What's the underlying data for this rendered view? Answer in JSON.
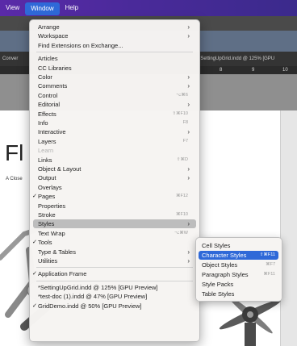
{
  "menubar": {
    "items": [
      {
        "label": "View",
        "active": false
      },
      {
        "label": "Window",
        "active": true
      },
      {
        "label": "Help",
        "active": false
      }
    ]
  },
  "background": {
    "doc_left_text": "Conver",
    "doc_title": "*SettingUpGrid.indd @ 125% [GPU",
    "ruler_ticks": [
      "8",
      "9",
      "10"
    ],
    "page_heading": "Fl",
    "page_subheading": "A Close"
  },
  "window_menu": {
    "items": [
      {
        "label": "Arrange",
        "shortcut": "",
        "submenu": true,
        "disabled": false,
        "checked": false
      },
      {
        "label": "Workspace",
        "shortcut": "",
        "submenu": true,
        "disabled": false,
        "checked": false
      },
      {
        "label": "Find Extensions on Exchange...",
        "shortcut": "",
        "submenu": false,
        "disabled": false,
        "checked": false
      },
      {
        "sep": true
      },
      {
        "label": "Articles",
        "shortcut": "",
        "submenu": false,
        "disabled": false,
        "checked": false
      },
      {
        "label": "CC Libraries",
        "shortcut": "",
        "submenu": false,
        "disabled": false,
        "checked": false
      },
      {
        "label": "Color",
        "shortcut": "",
        "submenu": true,
        "disabled": false,
        "checked": false
      },
      {
        "label": "Comments",
        "shortcut": "",
        "submenu": true,
        "disabled": false,
        "checked": false
      },
      {
        "label": "Control",
        "shortcut": "⌥⌘6",
        "submenu": false,
        "disabled": false,
        "checked": false
      },
      {
        "label": "Editorial",
        "shortcut": "",
        "submenu": true,
        "disabled": false,
        "checked": false
      },
      {
        "label": "Effects",
        "shortcut": "⇧⌘F10",
        "submenu": false,
        "disabled": false,
        "checked": false
      },
      {
        "label": "Info",
        "shortcut": "F8",
        "submenu": false,
        "disabled": false,
        "checked": false
      },
      {
        "label": "Interactive",
        "shortcut": "",
        "submenu": true,
        "disabled": false,
        "checked": false
      },
      {
        "label": "Layers",
        "shortcut": "F7",
        "submenu": false,
        "disabled": false,
        "checked": false
      },
      {
        "label": "Learn",
        "shortcut": "",
        "submenu": false,
        "disabled": true,
        "checked": false
      },
      {
        "label": "Links",
        "shortcut": "⇧⌘D",
        "submenu": false,
        "disabled": false,
        "checked": false
      },
      {
        "label": "Object & Layout",
        "shortcut": "",
        "submenu": true,
        "disabled": false,
        "checked": false
      },
      {
        "label": "Output",
        "shortcut": "",
        "submenu": true,
        "disabled": false,
        "checked": false
      },
      {
        "label": "Overlays",
        "shortcut": "",
        "submenu": false,
        "disabled": false,
        "checked": false
      },
      {
        "label": "Pages",
        "shortcut": "⌘F12",
        "submenu": false,
        "disabled": false,
        "checked": true
      },
      {
        "label": "Properties",
        "shortcut": "",
        "submenu": false,
        "disabled": false,
        "checked": false
      },
      {
        "label": "Stroke",
        "shortcut": "⌘F10",
        "submenu": false,
        "disabled": false,
        "checked": false
      },
      {
        "label": "Styles",
        "shortcut": "",
        "submenu": true,
        "disabled": false,
        "checked": false,
        "highlighted": true
      },
      {
        "label": "Text Wrap",
        "shortcut": "⌥⌘W",
        "submenu": false,
        "disabled": false,
        "checked": false
      },
      {
        "label": "Tools",
        "shortcut": "",
        "submenu": false,
        "disabled": false,
        "checked": true
      },
      {
        "label": "Type & Tables",
        "shortcut": "",
        "submenu": true,
        "disabled": false,
        "checked": false
      },
      {
        "label": "Utilities",
        "shortcut": "",
        "submenu": true,
        "disabled": false,
        "checked": false
      },
      {
        "sep": true
      },
      {
        "label": "Application Frame",
        "shortcut": "",
        "submenu": false,
        "disabled": false,
        "checked": true
      },
      {
        "sep": true
      },
      {
        "label": "*SettingUpGrid.indd @ 125% [GPU Preview]",
        "shortcut": "",
        "submenu": false,
        "disabled": false,
        "checked": false
      },
      {
        "label": "*test-doc (1).indd @ 47% [GPU Preview]",
        "shortcut": "",
        "submenu": false,
        "disabled": false,
        "checked": false
      },
      {
        "label": "GridDemo.indd @ 50% [GPU Preview]",
        "shortcut": "",
        "submenu": false,
        "disabled": false,
        "checked": true
      }
    ]
  },
  "styles_submenu": {
    "items": [
      {
        "label": "Cell Styles",
        "shortcut": "",
        "selected": false
      },
      {
        "label": "Character Styles",
        "shortcut": "⇧⌘F11",
        "selected": true
      },
      {
        "label": "Object Styles",
        "shortcut": "⌘F7",
        "selected": false
      },
      {
        "label": "Paragraph Styles",
        "shortcut": "⌘F11",
        "selected": false
      },
      {
        "label": "Style Packs",
        "shortcut": "",
        "selected": false
      },
      {
        "label": "Table Styles",
        "shortcut": "",
        "selected": false
      }
    ]
  },
  "colors": {
    "menubar_purple": "#4a2a9a",
    "selection_blue": "#2f69d8",
    "highlight_gray": "#bdbdbd"
  },
  "icons": {
    "submenu_arrow": "chevron-right-icon",
    "checkmark": "checkmark-icon"
  }
}
